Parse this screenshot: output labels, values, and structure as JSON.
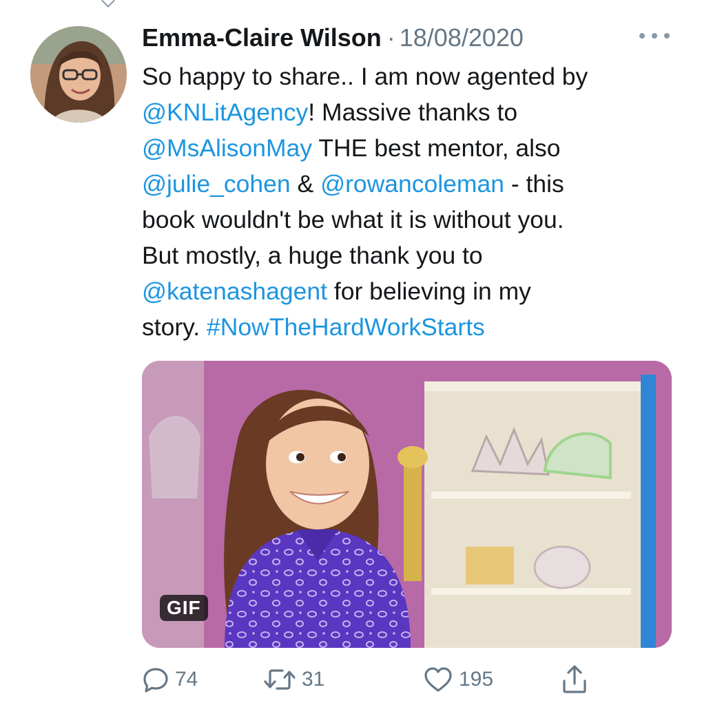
{
  "tweet": {
    "author": "Emma-Claire Wilson",
    "separator": "·",
    "date": "18/08/2020",
    "text_lines": [
      [
        {
          "t": "So happy to share.. I am now agented by",
          "link": false
        }
      ],
      [
        {
          "t": "@KNLitAgency",
          "link": true
        },
        {
          "t": "! Massive thanks to",
          "link": false
        }
      ],
      [
        {
          "t": "@MsAlisonMay",
          "link": true
        },
        {
          "t": " THE best mentor, also",
          "link": false
        }
      ],
      [
        {
          "t": "@julie_cohen",
          "link": true
        },
        {
          "t": " & ",
          "link": false
        },
        {
          "t": "@rowancoleman",
          "link": true
        },
        {
          "t": " - this",
          "link": false
        }
      ],
      [
        {
          "t": "book wouldn't be what it is without you.",
          "link": false
        }
      ],
      [
        {
          "t": "But mostly, a huge thank you to",
          "link": false
        }
      ],
      [
        {
          "t": "@katenashagent",
          "link": true
        },
        {
          "t": " for believing in my",
          "link": false
        }
      ],
      [
        {
          "t": "story. ",
          "link": false
        },
        {
          "t": "#NowTheHardWorkStarts",
          "link": true
        }
      ]
    ],
    "media": {
      "badge": "GIF"
    }
  },
  "actions": {
    "reply_count": "74",
    "retweet_count": "31",
    "like_count": "195"
  },
  "icons": {
    "reply": "reply-icon",
    "retweet": "retweet-icon",
    "like": "heart-icon",
    "share": "share-icon",
    "more": "more-options-icon"
  },
  "colors": {
    "link": "#1b95e0",
    "secondary_text": "#657786",
    "text": "#14171a"
  }
}
